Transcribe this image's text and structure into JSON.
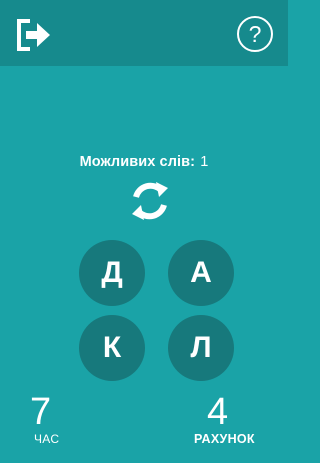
{
  "header": {
    "exit_icon": "exit-icon",
    "help_label": "?"
  },
  "game": {
    "possible_label": "Можливих слів:",
    "possible_count": "1",
    "shuffle_icon": "refresh-icon",
    "letters": [
      "Д",
      "А",
      "К",
      "Л"
    ]
  },
  "footer": {
    "time_value": "7",
    "time_label": "ЧАС",
    "score_value": "4",
    "score_label": "РАХУНОК"
  },
  "colors": {
    "background": "#1aa3a7",
    "topbar": "#168a8d",
    "tile": "#17797c",
    "text": "#ffffff"
  }
}
